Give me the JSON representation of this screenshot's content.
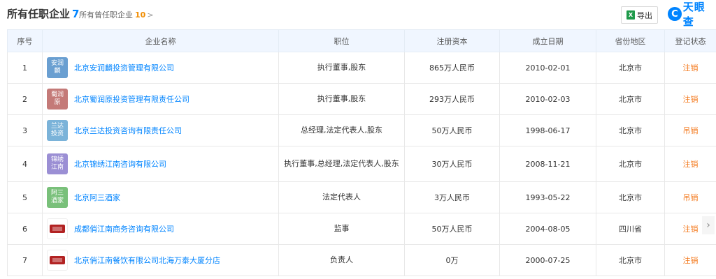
{
  "header": {
    "title": "所有任职企业",
    "title_count": "7",
    "sub_label": "所有曾任职企业",
    "sub_count": "10",
    "sub_chevron": ">",
    "export_label": "导出",
    "excel_icon": "X",
    "logo_mark": "C",
    "logo_text": "天眼查"
  },
  "columns": [
    "序号",
    "企业名称",
    "职位",
    "注册资本",
    "成立日期",
    "省份地区",
    "登记状态"
  ],
  "rows": [
    {
      "idx": "1",
      "logo_text": "安润麟",
      "logo_color": "#6a9fd1",
      "name": "北京安润麟投资管理有限公司",
      "position": "执行董事,股东",
      "capital": "865万人民币",
      "date": "2010-02-01",
      "province": "北京市",
      "status": "注销"
    },
    {
      "idx": "2",
      "logo_text": "蜀润原",
      "logo_color": "#c47a78",
      "name": "北京蜀润原投资管理有限责任公司",
      "position": "执行董事,股东",
      "capital": "293万人民币",
      "date": "2010-02-03",
      "province": "北京市",
      "status": "注销"
    },
    {
      "idx": "3",
      "logo_text": "兰达投资",
      "logo_color": "#7bb3d9",
      "name": "北京兰达投资咨询有限责任公司",
      "position": "总经理,法定代表人,股东",
      "capital": "50万人民币",
      "date": "1998-06-17",
      "province": "北京市",
      "status": "吊销"
    },
    {
      "idx": "4",
      "logo_text": "锦绣江南",
      "logo_color": "#9b8fd4",
      "name": "北京锦绣江南咨询有限公司",
      "position": "执行董事,总经理,法定代表人,股东",
      "capital": "30万人民币",
      "date": "2008-11-21",
      "province": "北京市",
      "status": "注销"
    },
    {
      "idx": "5",
      "logo_text": "阿三酒家",
      "logo_color": "#79c07a",
      "name": "北京阿三酒家",
      "position": "法定代表人",
      "capital": "3万人民币",
      "date": "1993-05-22",
      "province": "北京市",
      "status": "吊销"
    },
    {
      "idx": "6",
      "logo_text": "",
      "logo_color": "",
      "name": "成都俏江南商务咨询有限公司",
      "position": "监事",
      "capital": "50万人民币",
      "date": "2004-08-05",
      "province": "四川省",
      "status": "注销"
    },
    {
      "idx": "7",
      "logo_text": "",
      "logo_color": "",
      "name": "北京俏江南餐饮有限公司北海万泰大厦分店",
      "position": "负责人",
      "capital": "0万",
      "date": "2000-07-25",
      "province": "北京市",
      "status": "注销"
    }
  ],
  "pager_arrow": "›",
  "colors": {
    "accent": "#0084ff",
    "status": "#f47b20",
    "header_bg": "#f0f6ff"
  }
}
